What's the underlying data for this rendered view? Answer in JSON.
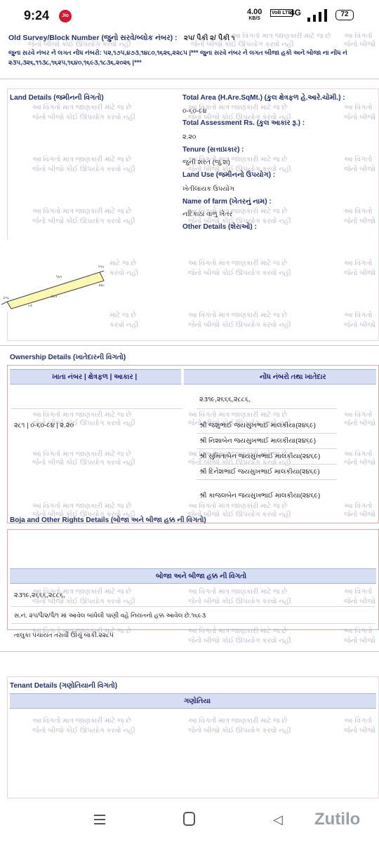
{
  "status_bar": {
    "time": "9:24",
    "carrier_badge": "Jio",
    "speed_value": "4.00",
    "speed_unit": "KB/S",
    "volte": "VoB LTE",
    "network": "4G",
    "battery": "72"
  },
  "watermark": {
    "line1": "આ વિગતો માત્ર જાણકારી માટે જ છે",
    "line2": "જેનો બીજો કોઈ ઊપયોગ કરવો નહી",
    "short1": "આ વિગતો",
    "short2": "જેનો બીજો"
  },
  "top": {
    "old_survey_label": "Old Survey/Block Number (જુનો સરવે/બ્લોક નંબર) :",
    "old_survey_value": "૨૫/ પૈકી ૨/ પૈકી ૧",
    "line2": "જુના સરવે નંબર ને લગત નોંધ નંબરો: ૫૨,૧૭૫,૪૭૩,૧૪૮૦,૧૬૨૬,૨૨૮૫ |*** જુના સરવે નંબર ને લગત બીજા હકો અને બોજા ના નોંધ નં",
    "line3": "૨૩૫,૩૨૬,૧૧૩૮,૧૬૨૫,૧૬૪૦,૧૬૯૩,૧૮૩૬,૨૦૨૬ |***"
  },
  "land": {
    "header": "Land Details (જમીનની વિગતો)",
    "total_area_label": "Total Area (H.Are.SqMt.) (કુલ ક્ષેત્રફળ હે.આરે.ચોમી.) :",
    "total_area_value": "૦-૬૦-૯૪",
    "assessment_label": "Total Assessment Rs. (કુલ આકાર રૂ.) :",
    "assessment_value": "૨.૨૦",
    "tenure_label": "Tenure (સત્તાપ્રકાર) :",
    "tenure_value": "જુની શરત (જુ.શ)",
    "land_use_label": "Land Use (જમીનનો ઉપયોગ) :",
    "land_use_value": "ખેતીલાયક ઉપયોગ",
    "farm_label": "Name of farm (ખેતરનું નામ) :",
    "farm_value": "નદિકાંઠા વાળું ખેતર",
    "other_label": "Other Details (શેરાઓ) :"
  },
  "map": {
    "labels": [
      "૧૧૫",
      "૧૬૫",
      "૯૨",
      "૩૬૫",
      "૭૫૮",
      "૩૬૯"
    ]
  },
  "ownership": {
    "header": "Ownership Details (ખાતેદારની વિગતો)",
    "col1": "ખાતા નંબર | ક્ષેત્રફળ | આકાર |",
    "col2": "નોંધ નંબરો તથા ખાતેદાર",
    "entry_numbers": "૨૩૧૯,૨૬૬૬,૨૮૮૬,",
    "khata_value": "૨૮૧ | ૦-૬૦-૯૪ | ૨.૨૦",
    "owners": [
      "શ્રી જશુભાઈ જયસુખભાઈ માલકીયા(૨૪૬૯)",
      "શ્રી નિશાબેન જયસુખભાઈ માલકીયા(૨૪૬૯)",
      "શ્રી સુમિતાબેન જયસુખભાઈ માલકીયા(૨૪૬૯)",
      "શ્રી દિનેશભાઈ જયસુખભાઈ માલકીયા(૨૪૬૯)",
      "શ્રી કાજલબેન જયસુખભાઈ માલકીયા(૨૪૬૯)"
    ]
  },
  "boja": {
    "header": "Boja and Other Rights Details (બોજા અને બીજા હક્ક ની વિગતો)",
    "col": "બોજા અને બીજા હક્ક ની વિગતો",
    "entry_numbers": "૨૩૧૯,૨૬૬૬,૨૮૮૬,",
    "line1": "સ.નં. ૨૫/પૈ/૨/પૈ/૧ માં આવેલ બાંધેલી પાણી વહે નિયતનો હક્ક આવેલ છે.૧૬૯૩",
    "line2": "તાલુકા પંચાયત તરાવી ઊંચું બાકી.૨૨૮૫"
  },
  "tenant": {
    "header": "Tenant Details (ગણોતિયાની વિગતો)",
    "col": "ગણોતિયા"
  },
  "nav": {
    "brand": "Zutilo"
  }
}
